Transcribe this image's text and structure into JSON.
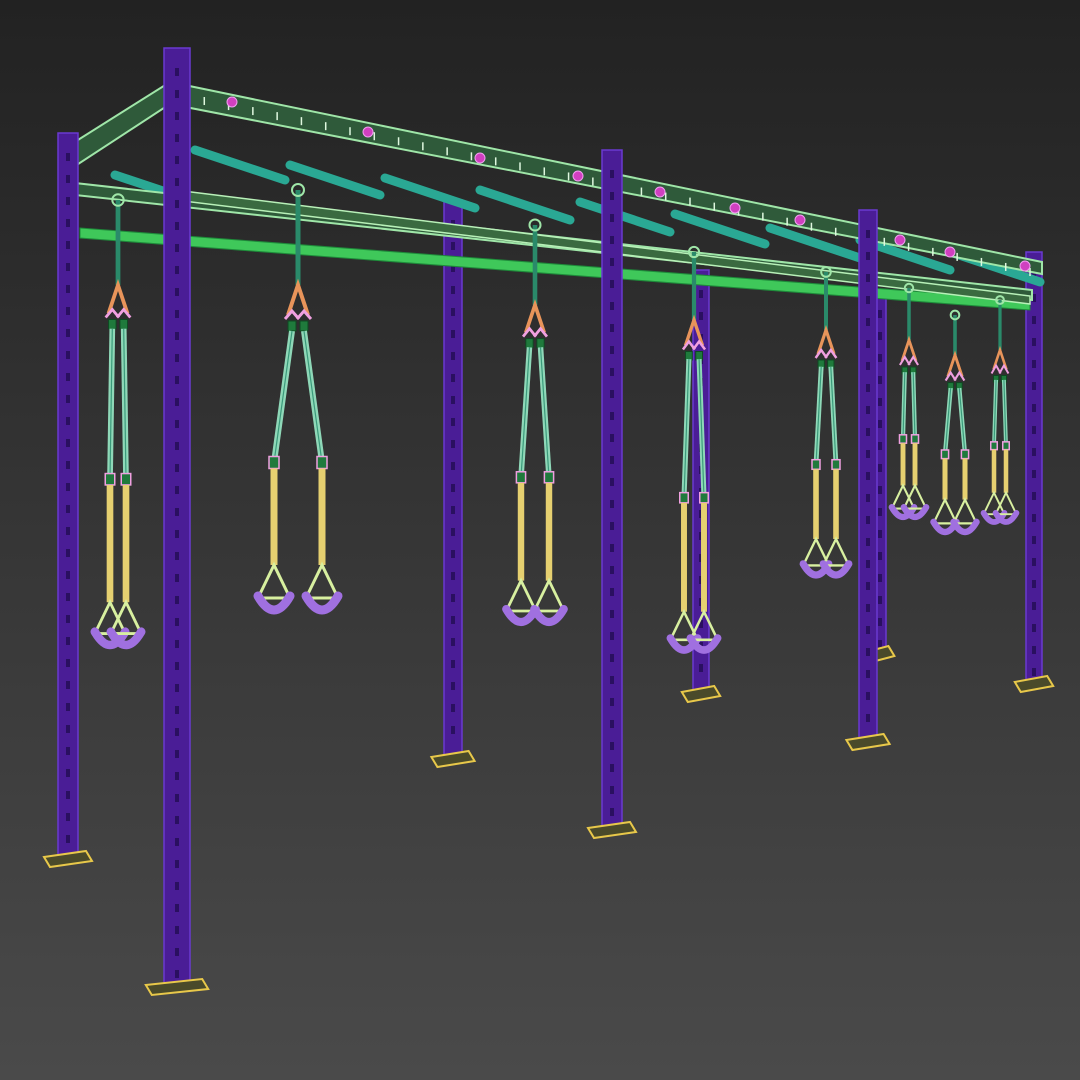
{
  "scene": {
    "subject": "wireframe-render-suspension-trainer-rig",
    "colors": {
      "background_top": "#222222",
      "background_bottom": "#4a4a4a",
      "post": "#4a1d96",
      "post_edge": "#6a3ad0",
      "frame_beam": "#9fe6a8",
      "frame_beam_back": "#3fc85a",
      "crossbar": "#2aa894",
      "bolt": "#d040c0",
      "base_plate": "#e8c84a",
      "strap": "#8fd8b8",
      "strap_dark": "#2a8a6a",
      "buckle": "#1f7a3c",
      "carabiner": "#e8945a",
      "clip": "#f0a0e0",
      "lower_strap": "#e6d070",
      "handle_grip": "#a070e0",
      "handle_frame": "#d8f0a0"
    }
  }
}
